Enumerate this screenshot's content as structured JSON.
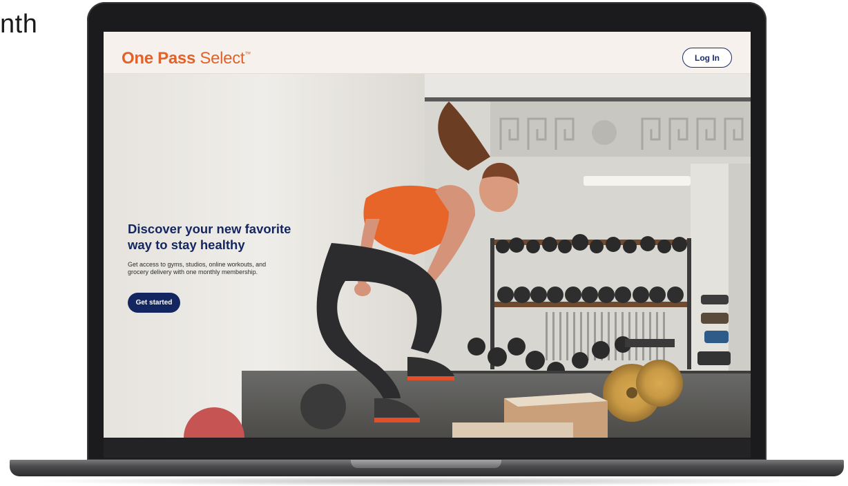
{
  "side_label": "nth",
  "site": {
    "logo_strong": "One Pass",
    "logo_light": " Select",
    "logo_mark": "™",
    "login_label": "Log In"
  },
  "hero": {
    "title_line1": "Discover your new favorite",
    "title_line2": "way to stay healthy",
    "subtitle_line1": "Get access to gyms, studios, online workouts, and",
    "subtitle_line2": "grocery delivery with one monthly membership.",
    "cta_label": "Get started"
  },
  "colors": {
    "brand_orange": "#e0632c",
    "brand_navy": "#14265f"
  }
}
